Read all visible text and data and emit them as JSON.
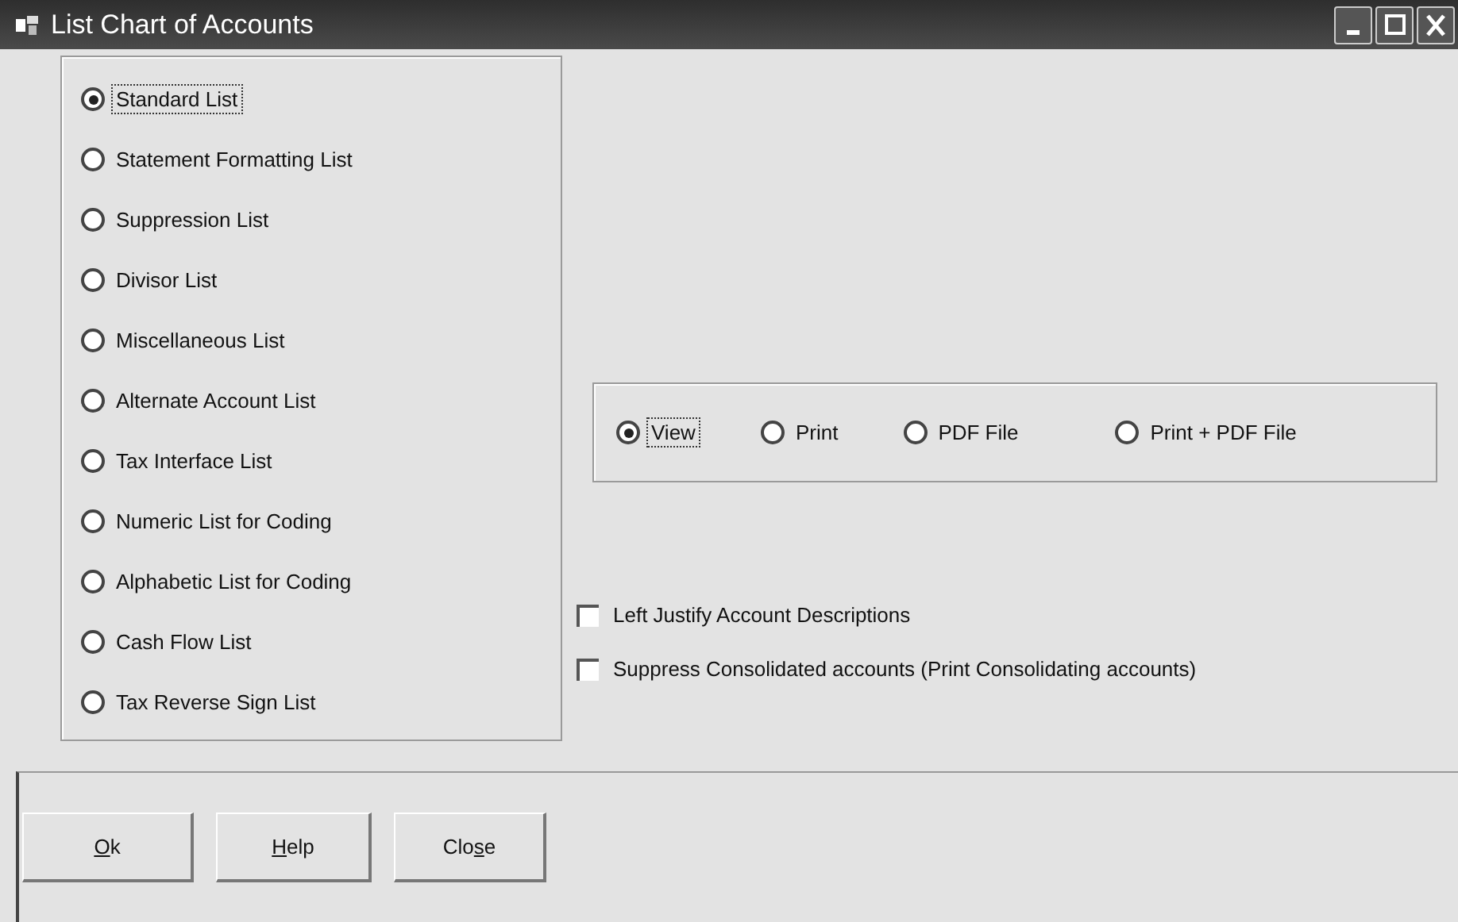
{
  "window": {
    "title": "List Chart of Accounts"
  },
  "list_types": [
    {
      "label": "Standard List",
      "selected": true
    },
    {
      "label": "Statement Formatting List",
      "selected": false
    },
    {
      "label": "Suppression List",
      "selected": false
    },
    {
      "label": "Divisor List",
      "selected": false
    },
    {
      "label": "Miscellaneous List",
      "selected": false
    },
    {
      "label": "Alternate Account List",
      "selected": false
    },
    {
      "label": "Tax Interface List",
      "selected": false
    },
    {
      "label": "Numeric List for Coding",
      "selected": false
    },
    {
      "label": "Alphabetic List for Coding",
      "selected": false
    },
    {
      "label": "Cash Flow List",
      "selected": false
    },
    {
      "label": "Tax Reverse Sign List",
      "selected": false
    }
  ],
  "output": [
    {
      "label": "View",
      "selected": true
    },
    {
      "label": "Print",
      "selected": false
    },
    {
      "label": "PDF File",
      "selected": false
    },
    {
      "label": "Print + PDF File",
      "selected": false
    }
  ],
  "options": [
    {
      "label": "Left Justify Account Descriptions",
      "checked": false
    },
    {
      "label": "Suppress Consolidated accounts (Print Consolidating accounts)",
      "checked": false
    }
  ],
  "buttons": [
    {
      "key": "O",
      "post": "k"
    },
    {
      "key": "H",
      "post": "elp"
    },
    {
      "pre": "Clo",
      "key": "s",
      "post": "e"
    }
  ]
}
